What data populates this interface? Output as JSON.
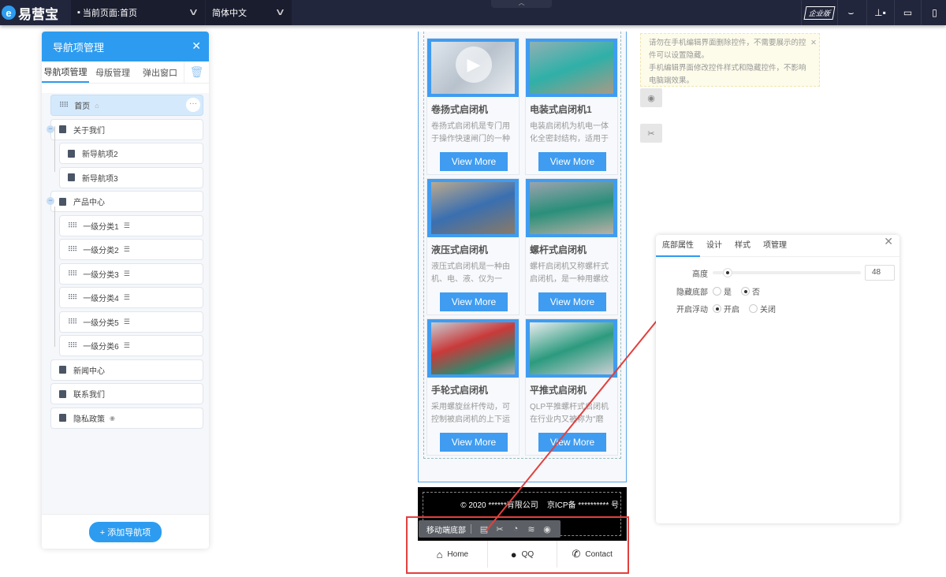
{
  "topbar": {
    "logo": "易营宝",
    "logo_badge": "e",
    "current_page": "当前页面:首页",
    "language": "简体中文",
    "edition": "企业版",
    "icons": [
      "eye-closed-icon",
      "align-icon",
      "desktop-icon",
      "mobile-icon"
    ]
  },
  "nav_panel": {
    "title": "导航项管理",
    "tabs": [
      "导航项管理",
      "母版管理",
      "弹出窗口"
    ],
    "items": [
      {
        "label": "首页",
        "level": 0
      },
      {
        "label": "关于我们",
        "level": 0
      },
      {
        "label": "新导航项2",
        "level": 1
      },
      {
        "label": "新导航项3",
        "level": 1
      },
      {
        "label": "产品中心",
        "level": 0
      },
      {
        "label": "一级分类1",
        "level": 1
      },
      {
        "label": "一级分类2",
        "level": 1
      },
      {
        "label": "一级分类3",
        "level": 1
      },
      {
        "label": "一级分类4",
        "level": 1
      },
      {
        "label": "一级分类5",
        "level": 1
      },
      {
        "label": "一级分类6",
        "level": 1
      },
      {
        "label": "新闻中心",
        "level": 0
      },
      {
        "label": "联系我们",
        "level": 0
      },
      {
        "label": "隐私政策",
        "level": 0
      }
    ],
    "add_button": "+ 添加导航项"
  },
  "products": [
    {
      "title": "卷扬式启闭机",
      "desc": "卷扬式启闭机是专门用于操作快速闸门的一种启...",
      "button": "View More"
    },
    {
      "title": "电装式启闭机1",
      "desc": "电装启闭机为机电一体化全密封结构，适用于户...",
      "button": "View More"
    },
    {
      "title": "液压式启闭机",
      "desc": "液压式启闭机是一种由机、电、液、仪为一体...",
      "button": "View More"
    },
    {
      "title": "螺杆式启闭机",
      "desc": "螺杆启闭机又称螺杆式启闭机，是一种用螺纹杆...",
      "button": "View More"
    },
    {
      "title": "手轮式启闭机",
      "desc": "采用螺旋丝杆传动，可控制被启闭机的上下运动...",
      "button": "View More"
    },
    {
      "title": "平推式启闭机",
      "desc": "QLP平推螺杆式启闭机在行业内又被称为\"磨盘...",
      "button": "View More"
    }
  ],
  "footer": {
    "copyright": "© 2020 ******有限公司",
    "icp": "京ICP备 ********** 号"
  },
  "bottom_nav": [
    {
      "label": "Home",
      "icon": "home-icon"
    },
    {
      "label": "QQ",
      "icon": "qq-icon"
    },
    {
      "label": "Contact",
      "icon": "phone-icon"
    }
  ],
  "toolbar": {
    "label": "移动端底部"
  },
  "tip": {
    "line1": "请勿在手机编辑界面删除控件，不需要展示的控件可以设置隐藏。",
    "line2": "手机编辑界面修改控件样式和隐藏控件，不影响电脑端效果。"
  },
  "props": {
    "tabs": [
      "底部属性",
      "设计",
      "样式",
      "项管理"
    ],
    "height_label": "高度",
    "height_value": "48",
    "height_fraction": 0.1,
    "hide_label": "隐藏底部",
    "hide_options": [
      "是",
      "否"
    ],
    "hide_selected": "否",
    "float_label": "开启浮动",
    "float_options": [
      "开启",
      "关闭"
    ],
    "float_selected": "开启"
  },
  "colors": {
    "accent": "#2d9cf0",
    "topbar": "#22263c",
    "annotation": "#e2403e"
  }
}
